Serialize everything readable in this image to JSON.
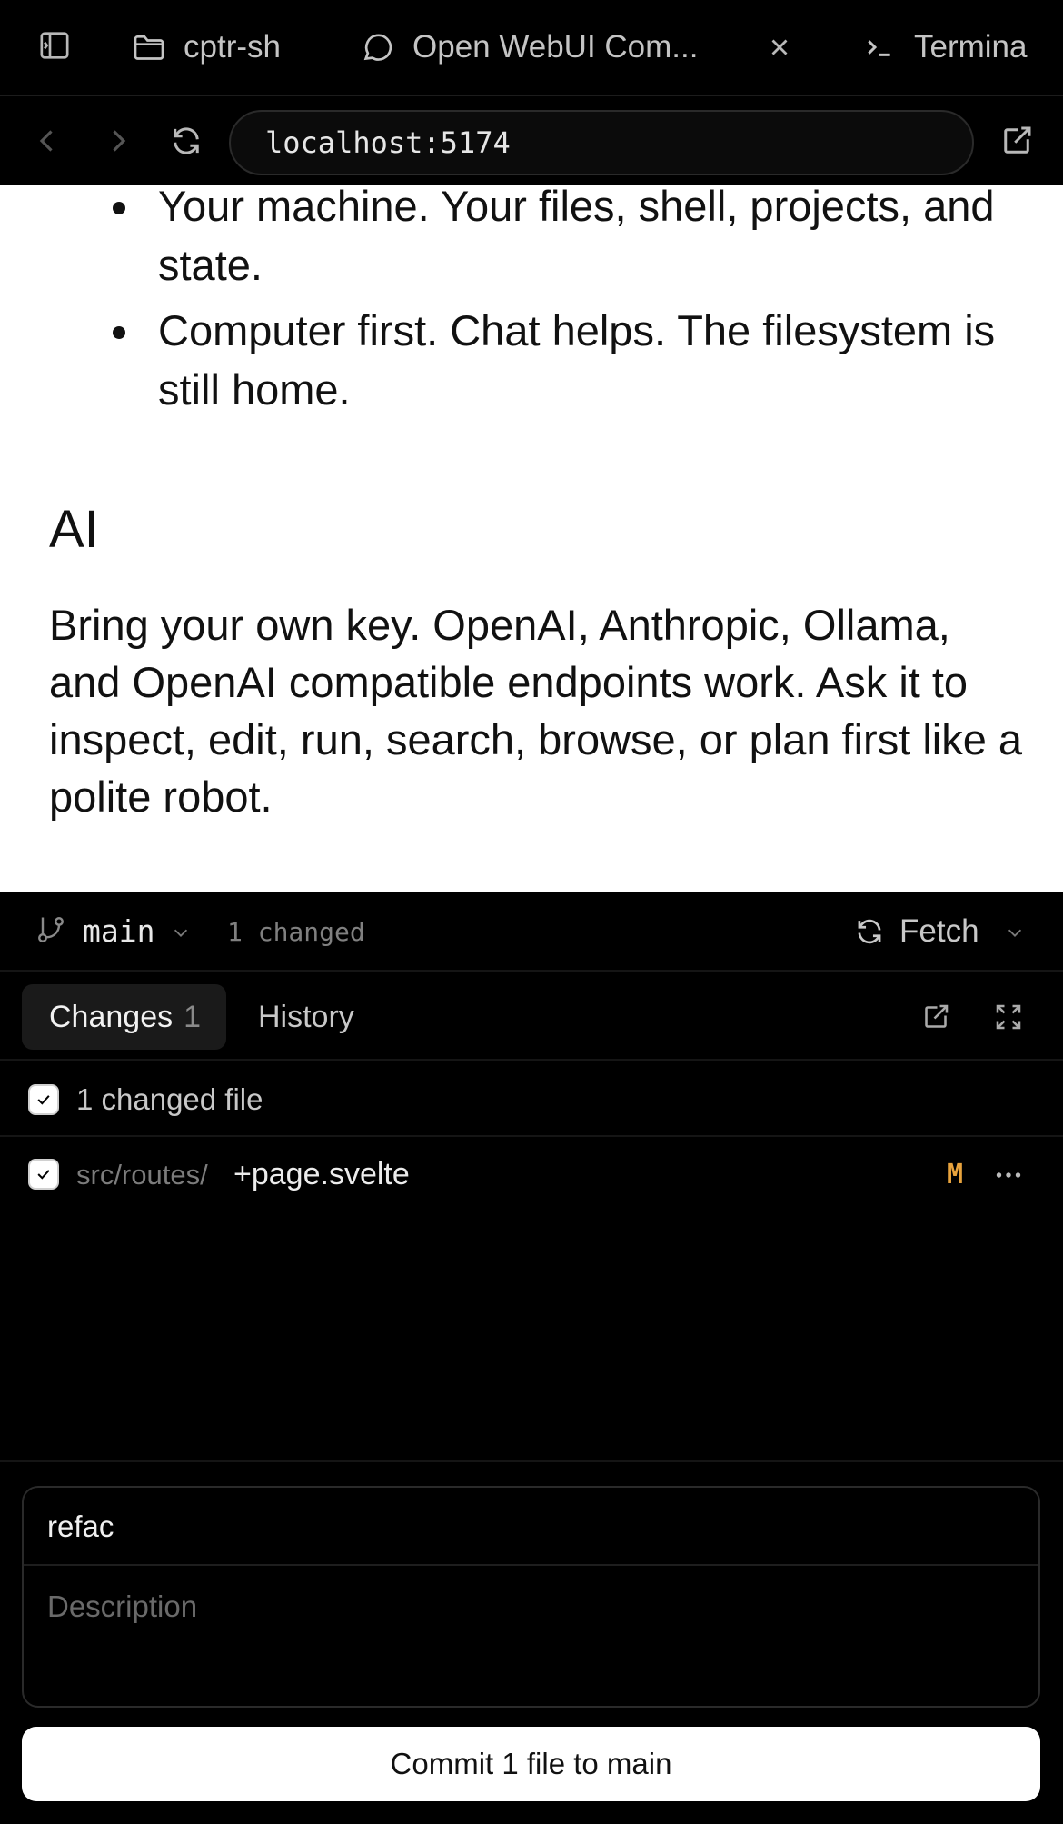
{
  "tabs": {
    "items": [
      {
        "label": "cptr-sh",
        "icon": "folder-icon"
      },
      {
        "label": "Open WebUI Com...",
        "icon": "chat-bubble-icon"
      },
      {
        "label": "Termina",
        "icon": "terminal-icon"
      }
    ]
  },
  "address": {
    "url": "localhost:5174"
  },
  "content": {
    "bullets": [
      "Your machine. Your files, shell, projects, and state.",
      "Computer first. Chat helps. The filesystem is still home."
    ],
    "heading": "AI",
    "paragraph": "Bring your own key. OpenAI, Anthropic, Ollama, and OpenAI compatible endpoints work. Ask it to inspect, edit, run, search, browse, or plan first like a polite robot."
  },
  "git": {
    "branch": "main",
    "changed_summary": "1 changed",
    "fetch_label": "Fetch",
    "tabs": {
      "changes_label": "Changes",
      "changes_count": "1",
      "history_label": "History"
    },
    "files_header": "1 changed file",
    "files": [
      {
        "dir": "src/routes/",
        "name": "+page.svelte",
        "status": "M"
      }
    ],
    "commit": {
      "summary_value": "refac",
      "description_placeholder": "Description",
      "button_label": "Commit 1 file to main"
    }
  },
  "colors": {
    "status_modified": "#e8a33d",
    "panel_bg": "#000000",
    "content_bg": "#ffffff"
  }
}
